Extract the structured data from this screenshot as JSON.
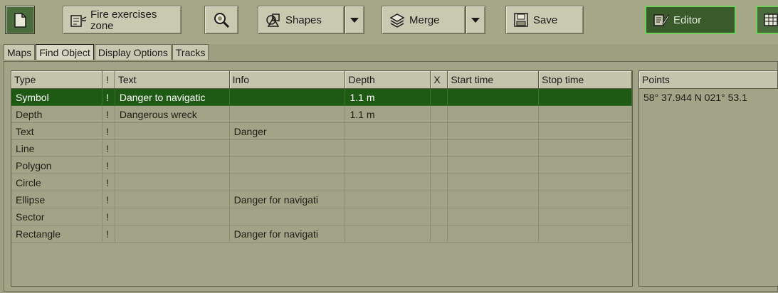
{
  "toolbar": {
    "zone_button_label": "Fire exercises zone",
    "shapes_label": "Shapes",
    "merge_label": "Merge",
    "save_label": "Save",
    "editor_label": "Editor"
  },
  "tabs": [
    {
      "label": "Maps",
      "active": false
    },
    {
      "label": "Find Object",
      "active": true
    },
    {
      "label": "Display Options",
      "active": false
    },
    {
      "label": "Tracks",
      "active": false
    }
  ],
  "table": {
    "columns": [
      "Type",
      "!",
      "Text",
      "Info",
      "Depth",
      "X",
      "Start time",
      "Stop time"
    ],
    "rows": [
      {
        "type": "Symbol",
        "flag": "!",
        "text": "Danger to navigatic",
        "info": "",
        "depth": "1.1 m",
        "x": "",
        "start": "",
        "stop": "",
        "selected": true
      },
      {
        "type": "Depth",
        "flag": "!",
        "text": "Dangerous wreck",
        "info": "",
        "depth": "1.1 m",
        "x": "",
        "start": "",
        "stop": ""
      },
      {
        "type": "Text",
        "flag": "!",
        "text": "",
        "info": "Danger",
        "depth": "",
        "x": "",
        "start": "",
        "stop": ""
      },
      {
        "type": "Line",
        "flag": "!",
        "text": "",
        "info": "",
        "depth": "",
        "x": "",
        "start": "",
        "stop": ""
      },
      {
        "type": "Polygon",
        "flag": "!",
        "text": "",
        "info": "",
        "depth": "",
        "x": "",
        "start": "",
        "stop": ""
      },
      {
        "type": "Circle",
        "flag": "!",
        "text": "",
        "info": "",
        "depth": "",
        "x": "",
        "start": "",
        "stop": ""
      },
      {
        "type": "Ellipse",
        "flag": "!",
        "text": "",
        "info": "Danger for navigati",
        "depth": "",
        "x": "",
        "start": "",
        "stop": ""
      },
      {
        "type": "Sector",
        "flag": "!",
        "text": "",
        "info": "",
        "depth": "",
        "x": "",
        "start": "",
        "stop": ""
      },
      {
        "type": "Rectangle",
        "flag": "!",
        "text": "",
        "info": "Danger for navigati",
        "depth": "",
        "x": "",
        "start": "",
        "stop": ""
      }
    ]
  },
  "points": {
    "header": "Points",
    "items": [
      "58° 37.944 N 021° 53.1"
    ]
  },
  "colors": {
    "background": "#9e9e80",
    "selected_row": "#1f5a14",
    "editor_border": "#6fd05a"
  },
  "icons": [
    "new-document-icon",
    "zone-icon",
    "search-zoom-icon",
    "shapes-icon",
    "merge-layers-icon",
    "save-disk-icon",
    "editor-icon",
    "table-icon"
  ]
}
